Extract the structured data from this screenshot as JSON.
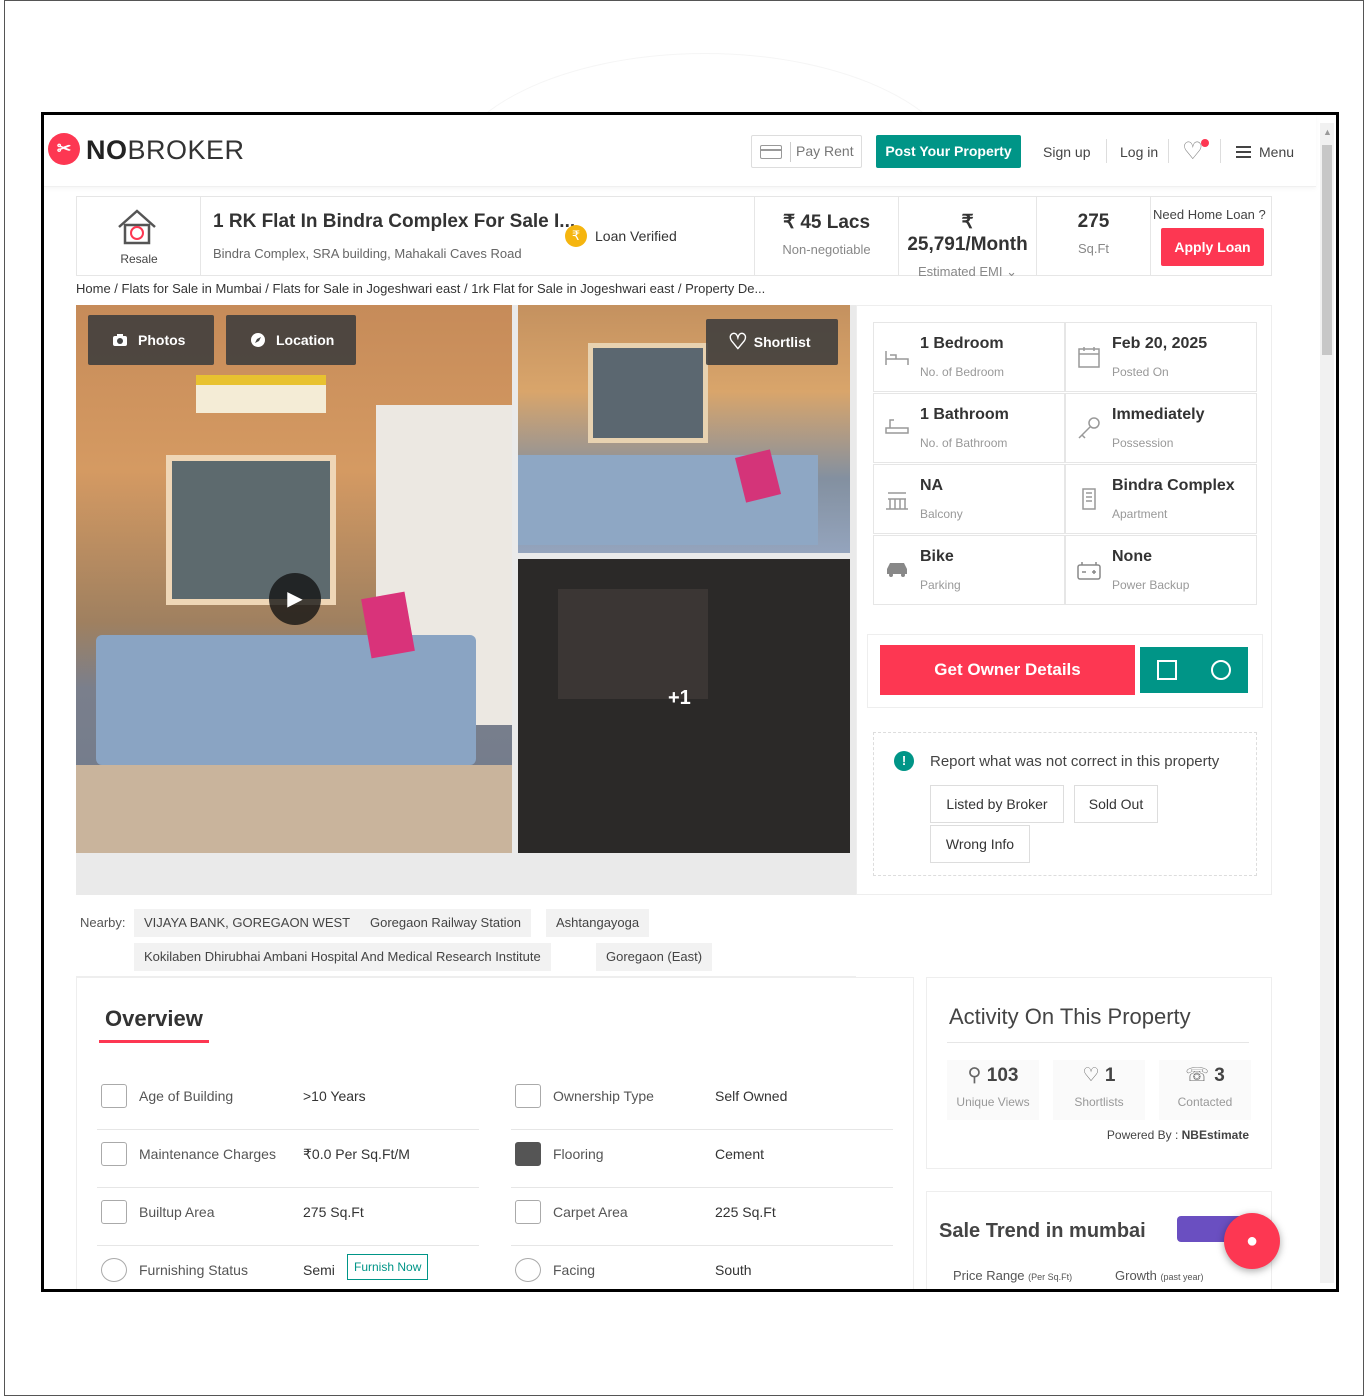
{
  "header": {
    "logo_text_bold": "NO",
    "logo_text_rest": "BROKER",
    "pay_rent": "Pay Rent",
    "post_property": "Post Your Property",
    "sign_up": "Sign up",
    "log_in": "Log in",
    "menu": "Menu"
  },
  "summary": {
    "type_label": "Resale",
    "title": "1 RK Flat In Bindra Complex For Sale I...",
    "address": "Bindra Complex, SRA building, Mahakali Caves Road",
    "loan_verified": "Loan Verified",
    "price": "₹ 45 Lacs",
    "price_note": "Non-negotiable",
    "emi": "₹ 25,791/Month",
    "emi_note": "Estimated EMI",
    "area": "275",
    "area_unit": "Sq.Ft",
    "loan_prompt": "Need Home Loan ?",
    "apply_loan": "Apply Loan"
  },
  "breadcrumb": "Home / Flats for Sale in Mumbai / Flats for Sale in Jogeshwari east / 1rk Flat for Sale in Jogeshwari east / Property De...",
  "photos": {
    "photos_btn": "Photos",
    "location_btn": "Location",
    "shortlist_btn": "Shortlist",
    "more_count": "+1"
  },
  "details": [
    {
      "value": "1 Bedroom",
      "label": "No. of Bedroom",
      "icon": "bed-icon"
    },
    {
      "value": "Feb 20, 2025",
      "label": "Posted On",
      "icon": "calendar-icon"
    },
    {
      "value": "1 Bathroom",
      "label": "No. of Bathroom",
      "icon": "bathtub-icon"
    },
    {
      "value": "Immediately",
      "label": "Possession",
      "icon": "key-icon"
    },
    {
      "value": "NA",
      "label": "Balcony",
      "icon": "balcony-icon"
    },
    {
      "value": "Bindra Complex",
      "label": "Apartment",
      "icon": "building-icon"
    },
    {
      "value": "Bike",
      "label": "Parking",
      "icon": "car-icon"
    },
    {
      "value": "None",
      "label": "Power Backup",
      "icon": "battery-icon"
    }
  ],
  "owner": {
    "get_owner_details": "Get Owner Details"
  },
  "report": {
    "title": "Report what was not correct in this property",
    "listed_by_broker": "Listed by Broker",
    "sold_out": "Sold Out",
    "wrong_info": "Wrong Info"
  },
  "nearby": {
    "label": "Nearby:",
    "items": [
      "VIJAYA BANK, GOREGAON WEST",
      "Goregaon Railway Station",
      "Ashtangayoga",
      "Kokilaben Dhirubhai Ambani Hospital And Medical Research Institute",
      "Goregaon (East)"
    ]
  },
  "overview": {
    "title": "Overview",
    "rows": [
      {
        "label": "Age of Building",
        "value": ">10 Years",
        "icon": "building-age-icon"
      },
      {
        "label": "Ownership Type",
        "value": "Self Owned",
        "icon": "ownership-icon"
      },
      {
        "label": "Maintenance Charges",
        "value": "₹0.0 Per Sq.Ft/M",
        "icon": "maintenance-icon"
      },
      {
        "label": "Flooring",
        "value": "Cement",
        "icon": "flooring-icon"
      },
      {
        "label": "Builtup Area",
        "value": "275 Sq.Ft",
        "icon": "builtup-area-icon"
      },
      {
        "label": "Carpet Area",
        "value": "225 Sq.Ft",
        "icon": "carpet-area-icon"
      },
      {
        "label": "Furnishing Status",
        "value": "Semi",
        "icon": "sofa-icon"
      },
      {
        "label": "Facing",
        "value": "South",
        "icon": "compass-icon"
      }
    ],
    "furnish_now": "Furnish Now"
  },
  "activity": {
    "title": "Activity On This Property",
    "views": "103",
    "views_label": "Unique Views",
    "shortlists": "1",
    "shortlists_label": "Shortlists",
    "contacted": "3",
    "contacted_label": "Contacted",
    "powered_by": "Powered By :",
    "powered_by_brand": "NBEstimate"
  },
  "trend": {
    "title": "Sale Trend in mumbai",
    "price_range": "Price Range",
    "price_range_unit": "(Per Sq.Ft)",
    "growth": "Growth",
    "growth_unit": "(past year)"
  },
  "colors": {
    "brand_red": "#fd3752",
    "brand_teal": "#009587",
    "loan_yellow": "#f5b50f"
  }
}
